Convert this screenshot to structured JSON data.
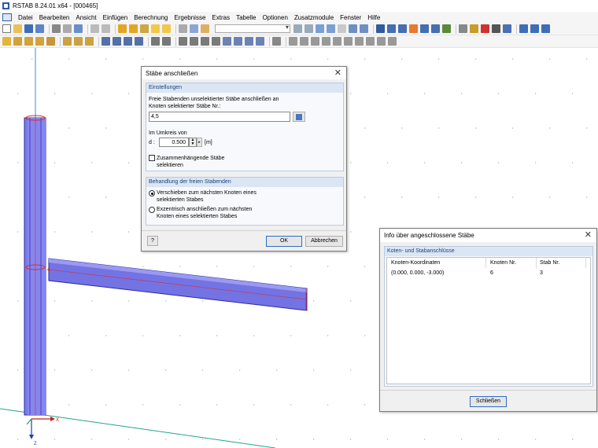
{
  "window": {
    "title": "RSTAB 8.24.01 x64 - [000465]"
  },
  "menu": {
    "items": [
      "Datei",
      "Bearbeiten",
      "Ansicht",
      "Einfügen",
      "Berechnung",
      "Ergebnisse",
      "Extras",
      "Tabelle",
      "Optionen",
      "Zusatzmodule",
      "Fenster",
      "Hilfe"
    ]
  },
  "dialog_connect": {
    "title": "Stäbe anschließen",
    "group_settings": "Einstellungen",
    "text_line1": "Freie Stabenden unselektierter Stäbe anschließen an",
    "text_line2": "Knoten selektierter Stäbe Nr.:",
    "members_value": "4,5",
    "radius_label": "Im Umkreis von",
    "d_label": "d :",
    "d_value": "0.500",
    "d_unit": "[m]",
    "check_line1": "Zusammenhängende Stäbe",
    "check_line2": "selektieren",
    "group_free_ends": "Behandlung der freien Stabenden",
    "radio1_line1": "Verschieben zum nächsten Knoten eines",
    "radio1_line2": "selektierten Stabes",
    "radio2_line1": "Exzentrisch anschließen zum nächsten",
    "radio2_line2": "Knoten eines selektierten Stabes",
    "ok_label": "OK",
    "cancel_label": "Abbrechen"
  },
  "dialog_info": {
    "title": "Info über angeschlossene Stäbe",
    "group_title": "Koten- und Stabanschlüsse",
    "columns": [
      "Knoten-Koordinaten",
      "Knoten Nr.",
      "Stab Nr."
    ],
    "rows": [
      {
        "coords": "(0.000, 0.000, -3.000)",
        "node": "6",
        "member": "3"
      }
    ],
    "close_label": "Schließen"
  },
  "axes": {
    "x": "X",
    "z": "Z"
  },
  "colors": {
    "member_fill": "#7b7bea",
    "member_edge": "#2a2aa0",
    "axis_green": "#1fa58a",
    "axis_blue": "#3a8fd1"
  }
}
